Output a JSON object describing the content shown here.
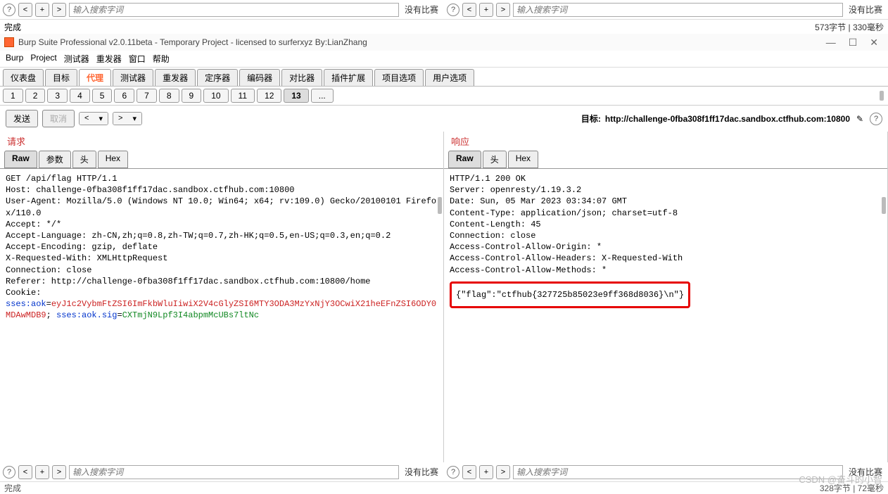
{
  "top": {
    "search_placeholder": "输入搜索字词",
    "no_match": "没有比赛",
    "status_left": "完成",
    "status_right": "573字节 | 330毫秒"
  },
  "window": {
    "title": "Burp Suite Professional v2.0.11beta - Temporary Project - licensed to surferxyz By:LianZhang"
  },
  "menu": {
    "items": [
      "Burp",
      "Project",
      "测试器",
      "重发器",
      "窗口",
      "帮助"
    ]
  },
  "main_tabs": {
    "items": [
      "仪表盘",
      "目标",
      "代理",
      "测试器",
      "重发器",
      "定序器",
      "编码器",
      "对比器",
      "插件扩展",
      "项目选项",
      "用户选项"
    ],
    "active_index": 2
  },
  "num_tabs": {
    "items": [
      "1",
      "2",
      "3",
      "4",
      "5",
      "6",
      "7",
      "8",
      "9",
      "10",
      "11",
      "12",
      "13",
      "..."
    ],
    "active_index": 12
  },
  "actions": {
    "send": "发送",
    "cancel": "取消",
    "target_label": "目标:",
    "target_url": "http://challenge-0fba308f1ff17dac.sandbox.ctfhub.com:10800"
  },
  "request": {
    "title": "请求",
    "sub_tabs": [
      "Raw",
      "参数",
      "头",
      "Hex"
    ],
    "active_sub": 0,
    "lines": [
      "GET /api/flag HTTP/1.1",
      "Host: challenge-0fba308f1ff17dac.sandbox.ctfhub.com:10800",
      "User-Agent: Mozilla/5.0 (Windows NT 10.0; Win64; x64; rv:109.0) Gecko/20100101 Firefox/110.0",
      "Accept: */*",
      "Accept-Language: zh-CN,zh;q=0.8,zh-TW;q=0.7,zh-HK;q=0.5,en-US;q=0.3,en;q=0.2",
      "Accept-Encoding: gzip, deflate",
      "X-Requested-With: XMLHttpRequest",
      "Connection: close",
      "Referer: http://challenge-0fba308f1ff17dac.sandbox.ctfhub.com:10800/home",
      "Cookie:"
    ],
    "cookie": {
      "k1": "sses:aok",
      "v1": "eyJ1c2VybmFtZSI6ImFkbWluIiwiX2V4cGlyZSI6MTY3ODA3MzYxNjY3OCwiX21heEFnZSI6ODY0MDAwMDB9",
      "sep": "; ",
      "k2": "sses:aok.sig",
      "v2": "CXTmjN9Lpf3I4abpmMcUBs7ltNc"
    }
  },
  "response": {
    "title": "响应",
    "sub_tabs": [
      "Raw",
      "头",
      "Hex"
    ],
    "active_sub": 0,
    "lines": [
      "HTTP/1.1 200 OK",
      "Server: openresty/1.19.3.2",
      "Date: Sun, 05 Mar 2023 03:34:07 GMT",
      "Content-Type: application/json; charset=utf-8",
      "Content-Length: 45",
      "Connection: close",
      "Access-Control-Allow-Origin: *",
      "Access-Control-Allow-Headers: X-Requested-With",
      "Access-Control-Allow-Methods: *"
    ],
    "body": "{\"flag\":\"ctfhub{327725b85023e9ff368d8036}\\n\"}"
  },
  "bottom": {
    "search_placeholder": "输入搜索字词",
    "no_match": "没有比赛",
    "status_left": "完成",
    "status_right": "328字节 | 72毫秒"
  },
  "watermark": "CSDN @奋斗的小智"
}
